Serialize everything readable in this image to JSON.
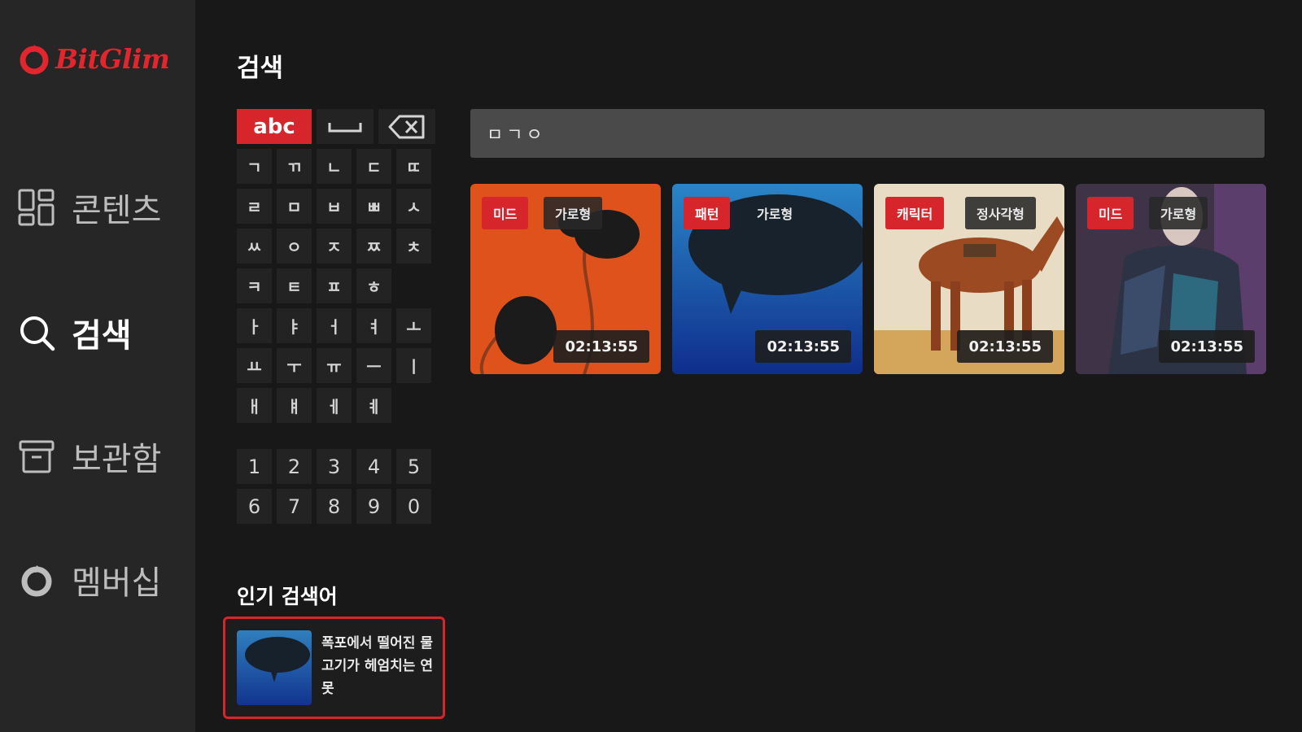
{
  "brand": {
    "name": "BitGlim",
    "accent": "#d6252b"
  },
  "sidebar": {
    "items": [
      {
        "id": "contents",
        "label": "콘텐츠",
        "icon": "grid-icon",
        "active": false
      },
      {
        "id": "search",
        "label": "검색",
        "icon": "search-icon",
        "active": true
      },
      {
        "id": "archive",
        "label": "보관함",
        "icon": "archive-box-icon",
        "active": false
      },
      {
        "id": "membership",
        "label": "멤버십",
        "icon": "membership-icon",
        "active": false
      }
    ]
  },
  "page": {
    "title": "검색"
  },
  "keypad": {
    "mode_label": "abc",
    "space_icon": "space-icon",
    "backspace_icon": "backspace-icon",
    "rows": [
      [
        "ㄱ",
        "ㄲ",
        "ㄴ",
        "ㄷ",
        "ㄸ"
      ],
      [
        "ㄹ",
        "ㅁ",
        "ㅂ",
        "ㅃ",
        "ㅅ"
      ],
      [
        "ㅆ",
        "ㅇ",
        "ㅈ",
        "ㅉ",
        "ㅊ"
      ],
      [
        "ㅋ",
        "ㅌ",
        "ㅍ",
        "ㅎ"
      ],
      [
        "ㅏ",
        "ㅑ",
        "ㅓ",
        "ㅕ",
        "ㅗ"
      ],
      [
        "ㅛ",
        "ㅜ",
        "ㅠ",
        "ㅡ",
        "ㅣ"
      ],
      [
        "ㅐ",
        "ㅒ",
        "ㅔ",
        "ㅖ"
      ]
    ],
    "numbers": [
      [
        "1",
        "2",
        "3",
        "4",
        "5"
      ],
      [
        "6",
        "7",
        "8",
        "9",
        "0"
      ]
    ]
  },
  "search": {
    "query": "ㅁㄱㅇ"
  },
  "results": [
    {
      "category": "미드",
      "gallery": "가로형",
      "duration": "02:13:55",
      "art": "red-flowers"
    },
    {
      "category": "패턴",
      "gallery": "가로형",
      "duration": "02:13:55",
      "art": "blue-tree"
    },
    {
      "category": "캐릭터",
      "gallery": "정사각형",
      "duration": "02:13:55",
      "art": "horse"
    },
    {
      "category": "미드",
      "gallery": "가로형",
      "duration": "02:13:55",
      "art": "figure"
    }
  ],
  "popular": {
    "title": "인기 검색어",
    "items": [
      {
        "text": "폭포에서 떨어진 물고기가 헤엄치는 연못"
      }
    ]
  }
}
